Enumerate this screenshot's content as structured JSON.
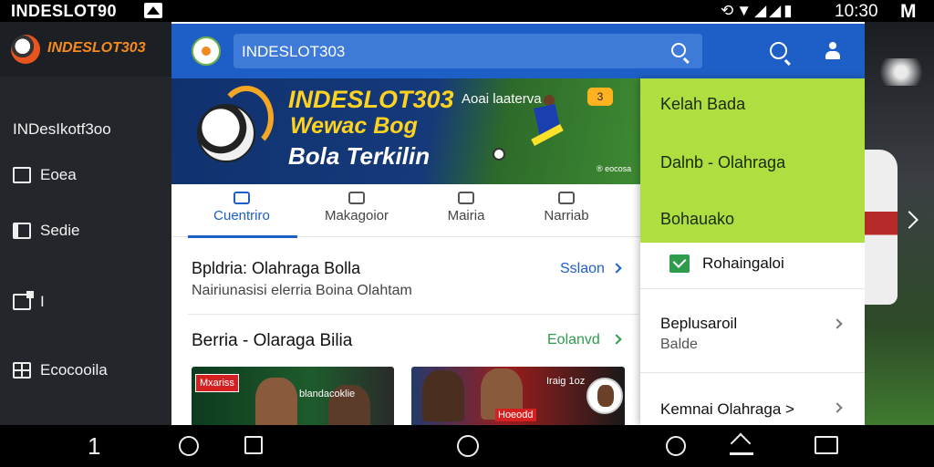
{
  "status_bar": {
    "app_name": "INDESLOT90",
    "time": "10:30",
    "right_logo": "M",
    "icons": [
      "sync-icon",
      "wifi-icon",
      "signal-icon",
      "battery-icon"
    ]
  },
  "drawer": {
    "brand": "INDESLOT303",
    "subtitle": "INDesIkotf3oo",
    "items": [
      {
        "label": "Eoea",
        "icon": "inbox-icon"
      },
      {
        "label": "Sedie",
        "icon": "book-icon"
      },
      {
        "label": "I",
        "icon": "edit-icon"
      },
      {
        "label": "Ecocooila",
        "icon": "grid-icon"
      }
    ]
  },
  "header": {
    "search_value": "INDESLOT303",
    "icons": [
      "search-icon",
      "search-icon",
      "user-icon"
    ]
  },
  "banner": {
    "title": "INDESLOT303",
    "tagline": "Aoai laaterva",
    "badge": "3",
    "line2": "Wewac Bog",
    "line3": "Bola Terkilin",
    "footer": "® eocosa"
  },
  "tabs": [
    {
      "label": "Cuentriro",
      "icon": "home-icon",
      "active": true
    },
    {
      "label": "Makagoior",
      "icon": "chat-icon",
      "active": false
    },
    {
      "label": "Mairia",
      "icon": "gamepad-icon",
      "active": false
    },
    {
      "label": "Narriab",
      "icon": "message-icon",
      "active": false
    }
  ],
  "sections": [
    {
      "title": "Bpldria: Olahraga Bolla",
      "subtitle": "Nairiunasisi elerria Boina Olahtam",
      "link": "Sslaon",
      "link_color": "#1d5fc6"
    },
    {
      "title": "Berria - Olaraga Bilia",
      "link": "Eolanvd",
      "link_color": "#2e9b4d"
    }
  ],
  "cards": [
    {
      "badge": "Mxariss",
      "caption": "blandacoklie"
    },
    {
      "caption": "Iraig 1oz",
      "caption2": "Hoeodd"
    }
  ],
  "dropdown": {
    "green_items": [
      "Kelah Bada",
      "Dalnb - Olahraga",
      "Bohauako"
    ],
    "sub_item": "Rohaingaloi",
    "rows": [
      {
        "title": "Beplusaroil",
        "subtitle": "Balde"
      },
      {
        "title": "Kemnai Olahraga >",
        "subtitle": ""
      }
    ]
  },
  "colors": {
    "accent_blue": "#1d5fc6",
    "menu_green": "#aede3f",
    "brand_orange": "#f58a1f"
  },
  "nav_bar": {
    "back_label": "1"
  }
}
